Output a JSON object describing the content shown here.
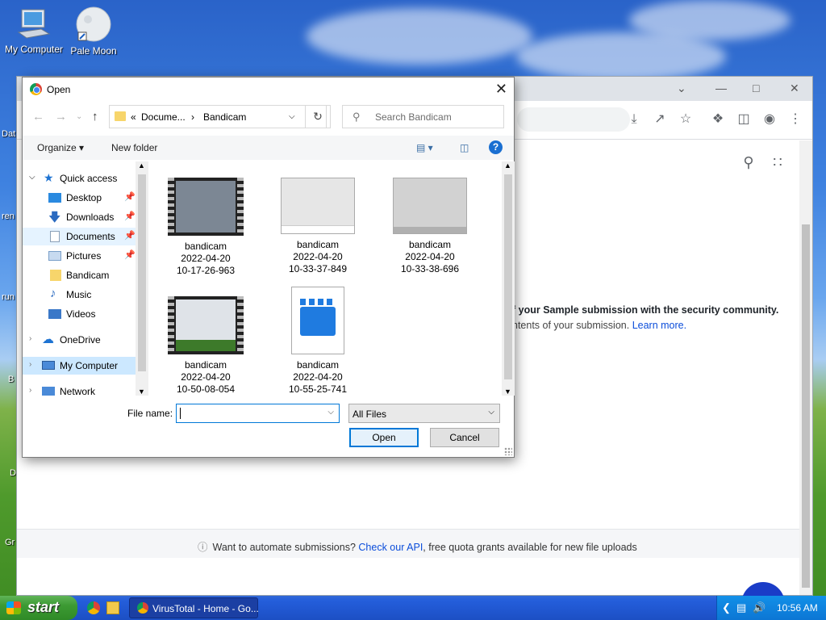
{
  "desktop": {
    "icons": [
      {
        "label": "My Computer"
      },
      {
        "label": "Pale Moon"
      }
    ],
    "edge_fragments": [
      "Dat",
      "ren",
      "run",
      "B",
      "D",
      "Gr"
    ]
  },
  "browser": {
    "content": {
      "line1": "f your Sample submission with the security community.",
      "line2_prefix": "ntents of your submission. ",
      "line2_link": "Learn more.",
      "footer_prefix": "Want to automate submissions? ",
      "footer_link": "Check our API",
      "footer_suffix": ", free quota grants available for new file uploads"
    }
  },
  "dialog": {
    "title": "Open",
    "breadcrumb": {
      "overflow": "«",
      "parent": "Docume...",
      "separator": "›",
      "current": "Bandicam"
    },
    "search_placeholder": "Search Bandicam",
    "organize_label": "Organize ▾",
    "new_folder_label": "New folder",
    "nav": [
      {
        "label": "Quick access",
        "icon": "star-icon",
        "color": "#1e73d2"
      },
      {
        "label": "Desktop",
        "icon": "desktop-icon",
        "color": "#2a8ae0",
        "pinned": true
      },
      {
        "label": "Downloads",
        "icon": "download-icon",
        "color": "#2a6ac0",
        "pinned": true
      },
      {
        "label": "Documents",
        "icon": "document-icon",
        "color": "#8aa0b8",
        "pinned": true
      },
      {
        "label": "Pictures",
        "icon": "picture-icon",
        "color": "#7a9fc8",
        "pinned": true
      },
      {
        "label": "Bandicam",
        "icon": "folder-icon",
        "color": "#f7d56b"
      },
      {
        "label": "Music",
        "icon": "music-icon",
        "color": "#2a6ac0"
      },
      {
        "label": "Videos",
        "icon": "video-icon",
        "color": "#3a78c8"
      },
      {
        "label": "OneDrive",
        "icon": "cloud-icon",
        "color": "#1e73d2"
      },
      {
        "label": "My Computer",
        "icon": "computer-icon",
        "color": "#4a8ad8"
      },
      {
        "label": "Network",
        "icon": "network-icon",
        "color": "#4a8ad8"
      }
    ],
    "files": [
      {
        "name": "bandicam",
        "date": "2022-04-20",
        "time": "10-17-26-963",
        "kind": "video"
      },
      {
        "name": "bandicam",
        "date": "2022-04-20",
        "time": "10-33-37-849",
        "kind": "image"
      },
      {
        "name": "bandicam",
        "date": "2022-04-20",
        "time": "10-33-38-696",
        "kind": "image"
      },
      {
        "name": "bandicam",
        "date": "2022-04-20",
        "time": "10-50-08-054",
        "kind": "video"
      },
      {
        "name": "bandicam",
        "date": "2022-04-20",
        "time": "10-55-25-741",
        "kind": "clapper"
      }
    ],
    "file_name_label": "File name:",
    "file_name_value": "",
    "filter_value": "All Files",
    "open_label": "Open",
    "cancel_label": "Cancel"
  },
  "taskbar": {
    "start_label": "start",
    "task_label": "VirusTotal - Home - Go...",
    "clock": "10:56 AM"
  },
  "colors": {
    "accent": "#0078d7",
    "link": "#0b4dda",
    "taskbar": "#245edb",
    "start": "#3c9a33"
  }
}
